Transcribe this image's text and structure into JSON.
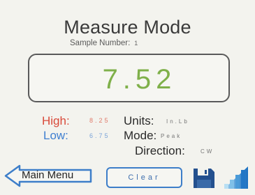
{
  "header": {
    "title": "Measure Mode",
    "sample_label": "Sample Number:",
    "sample_value": "1"
  },
  "display": {
    "reading": "7.52"
  },
  "stats": {
    "high_label": "High:",
    "high_value": "8.25",
    "low_label": "Low:",
    "low_value": "6.75"
  },
  "settings": {
    "units_label": "Units:",
    "units_value": "In.Lb",
    "mode_label": "Mode:",
    "mode_value": "Peak",
    "direction_label": "Direction:",
    "direction_value": "CW"
  },
  "footer": {
    "main_menu_label": "Main Menu",
    "clear_label": "Clear"
  },
  "icons": {
    "back": "left-arrow-icon",
    "save": "floppy-disk-icon",
    "signal": "signal-strength-icon"
  },
  "colors": {
    "reading": "#7fb04a",
    "high": "#d94a3a",
    "low": "#3f7fd0",
    "accent": "#3d7ec9",
    "save": "#24508e"
  }
}
